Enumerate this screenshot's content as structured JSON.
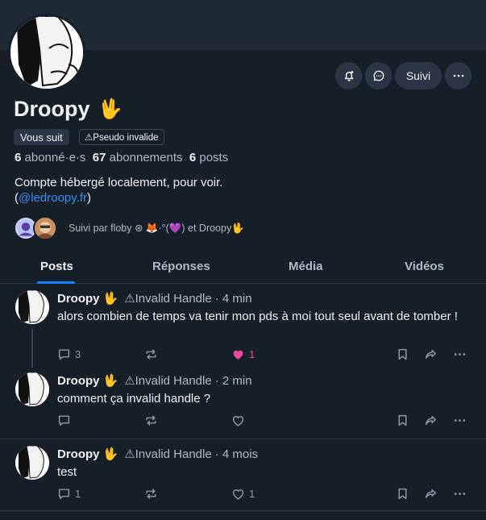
{
  "profile": {
    "display_name": "Droopy",
    "name_emoji": "🖖",
    "follows_you_badge": "Vous suit",
    "invalid_handle_badge": "⚠Pseudo invalide",
    "followers_count": "6",
    "followers_label": "abonné·e·s",
    "following_count": "67",
    "following_label": "abonnements",
    "posts_count": "6",
    "posts_label": "posts",
    "bio_line1": "Compte hébergé localement, pour voir.",
    "bio_paren_open": "(",
    "bio_link": "@ledroopy.fr",
    "bio_paren_close": ")",
    "followed_by_text": "Suivi par floby ⊛ 🦊·°(💜) et Droopy🖖",
    "follow_button_label": "Suivi",
    "icons": [
      "bell-plus-icon",
      "chat-bubble-icon",
      "more-icon"
    ]
  },
  "tabs": [
    {
      "label": "Posts",
      "active": true
    },
    {
      "label": "Réponses",
      "active": false
    },
    {
      "label": "Média",
      "active": false
    },
    {
      "label": "Vidéos",
      "active": false
    }
  ],
  "posts": [
    {
      "author": "Droopy",
      "emoji": "🖖",
      "handle": "⚠Invalid Handle",
      "time": "· 4 min",
      "text": "alors combien de temps va tenir mon pds à moi tout seul avant de tomber !",
      "reply_count": "3",
      "like_count": "1",
      "liked": true
    },
    {
      "author": "Droopy",
      "emoji": "🖖",
      "handle": "⚠Invalid Handle",
      "time": "· 2 min",
      "text": "comment ça invalid handle ?",
      "reply_count": "",
      "like_count": "",
      "liked": false
    },
    {
      "author": "Droopy",
      "emoji": "🖖",
      "handle": "⚠Invalid Handle",
      "time": "· 4 mois",
      "text": "test",
      "reply_count": "1",
      "like_count": "1",
      "liked": false
    }
  ],
  "colors": {
    "background": "#161e27",
    "accent": "#1083fe",
    "link": "#3b8cf2",
    "like": "#ec4899",
    "muted": "#aebbc9"
  }
}
